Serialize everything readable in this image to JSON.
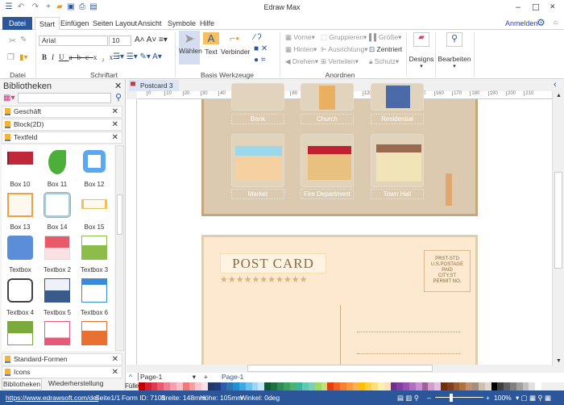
{
  "app": {
    "title": "Edraw Max"
  },
  "window": {
    "minimize": "–",
    "maximize": "☐",
    "close": "✕"
  },
  "menu_tabs": [
    "Datei",
    "Start",
    "Einfügen",
    "Seiten Layout",
    "Ansicht",
    "Symbole",
    "Hilfe"
  ],
  "account": {
    "login": "Anmelden"
  },
  "ribbon": {
    "groups": [
      "Datei",
      "Schriftart",
      "Basis Werkzeuge",
      "Anordnen"
    ],
    "font": "Arial",
    "font_size": "10",
    "tools": [
      "Wählen",
      "Text",
      "Verbinder"
    ],
    "arrange": [
      "Vorne",
      "Hinten",
      "Drehen",
      "Gruppieren",
      "Ausrichtung",
      "Verteilen",
      "Größe",
      "Zentriert",
      "Schutz"
    ],
    "designs": "Designs",
    "edit": "Bearbeiten"
  },
  "library": {
    "title": "Bibliotheken",
    "search_value": "",
    "categories": [
      "Geschäft",
      "Block(2D)",
      "Textfeld"
    ],
    "shapes": [
      "Box 10",
      "Box 11",
      "Box 12",
      "Box 13",
      "Box 14",
      "Box 15",
      "Textbox",
      "Textbox 2",
      "Textbox 3",
      "Textbox 4",
      "Textbox 5",
      "Textbox 6"
    ],
    "bottom_categories": [
      "Standard-Formen",
      "Icons"
    ],
    "tabs": [
      "Bibliotheken",
      "Wiederherstellung"
    ]
  },
  "document": {
    "tab": "Postcard 3"
  },
  "ruler": [
    "0",
    "10",
    "20",
    "30",
    "40",
    "50",
    "60",
    "70",
    "80",
    "90",
    "100",
    "110",
    "120",
    "130",
    "140",
    "150",
    "160",
    "170",
    "180",
    "190",
    "200",
    "210"
  ],
  "card_front": {
    "buildings": [
      "Bank",
      "Church",
      "Residential",
      "Market",
      "Fire Department",
      "Town Hall"
    ]
  },
  "card_back": {
    "title": "POST CARD",
    "stars": "★★★★★★★★★★★",
    "stamp": [
      "PRST-STD",
      "U.S.POSTAGE",
      "PAID",
      "CITY,ST",
      "PERMIT NO."
    ]
  },
  "pages": {
    "selector": "Page-1",
    "active": "Page-1",
    "add": "+"
  },
  "palette": {
    "label": "Füller",
    "colors": [
      "#c00000",
      "#d42030",
      "#e03850",
      "#e85a70",
      "#ef7f90",
      "#f4a0b0",
      "#f8c0c8",
      "#f07878",
      "#f4a0a0",
      "#f8c8d0",
      "#fbe0e8",
      "#1f3864",
      "#203c7c",
      "#2e5ca8",
      "#2f75b5",
      "#1f8fd0",
      "#40a8e0",
      "#70c0ec",
      "#9dd4f2",
      "#c5e6f8",
      "#0f5a3a",
      "#1e7040",
      "#2e8b57",
      "#38a060",
      "#50b070",
      "#3cb4a0",
      "#5fc8b0",
      "#7fd0b0",
      "#a0d860",
      "#c0e080",
      "#e04010",
      "#f06020",
      "#f88030",
      "#fa9a40",
      "#fcb050",
      "#ffc000",
      "#ffd040",
      "#ffe080",
      "#fff0b0",
      "#ffe0c0",
      "#703090",
      "#8040a0",
      "#9a50b0",
      "#b070c0",
      "#c890d0",
      "#a0609a",
      "#d0a0c8",
      "#e0c0e0",
      "#703010",
      "#804020",
      "#9a5a30",
      "#b07040",
      "#c09070",
      "#a09080",
      "#d0c0b0",
      "#e0d8d0",
      "#000000",
      "#404040",
      "#606060",
      "#808080",
      "#a0a0a0",
      "#c0c0c0",
      "#e0e0e0",
      "#ffffff"
    ]
  },
  "status": {
    "url": "https://www.edrawsoft.com/de/",
    "page": "Seite1/1",
    "form_id": "Form ID: 7101",
    "width": "Breite: 148mm",
    "height": "Höhe: 105mm",
    "angle": "Winkel: 0deg",
    "zoom": "100%",
    "zoom_level": 100
  }
}
